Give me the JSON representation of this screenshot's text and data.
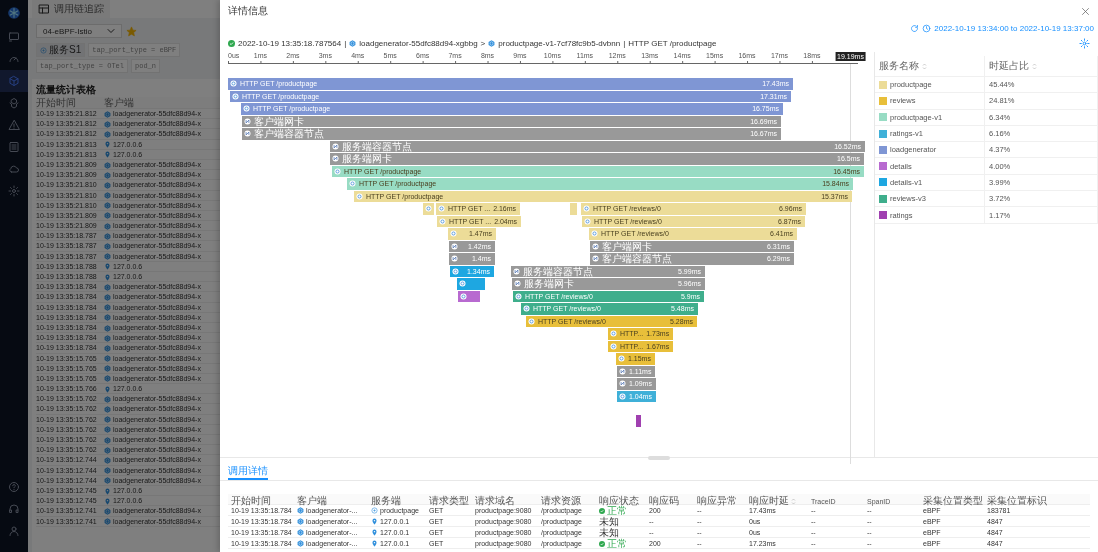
{
  "page": {
    "nav_items": [
      {
        "selected": false
      },
      {
        "selected": false
      },
      {
        "selected": true
      },
      {
        "selected": false
      },
      {
        "selected": false
      },
      {
        "selected": false
      },
      {
        "selected": false
      },
      {
        "selected": false
      },
      {
        "selected": false
      },
      {
        "selected": false
      },
      {
        "selected": false
      }
    ],
    "tab_title": "调用链追踪",
    "dropdown": "04-eBPF-Istio",
    "starred": true,
    "filters": [
      {
        "label": "服务S1",
        "kind": "service"
      },
      {
        "label": "tap_port_type = eBPF",
        "kind": "tag"
      },
      {
        "label": "tap_port_type = OTel",
        "kind": "tag"
      },
      {
        "label": "pod_n",
        "kind": "tag"
      }
    ],
    "table_title": "流量统计表格",
    "columns": [
      "开始时间",
      "客户端"
    ],
    "rows": [
      {
        "time": "10-19 13:35:21.812",
        "client": "loadgenerator-55dfc88d94-x",
        "kind": "pod"
      },
      {
        "time": "10-19 13:35:21.812",
        "client": "loadgenerator-55dfc88d94-x",
        "kind": "pod"
      },
      {
        "time": "10-19 13:35:21.812",
        "client": "loadgenerator-55dfc88d94-x",
        "kind": "pod"
      },
      {
        "time": "10-19 13:35:21.813",
        "client": "127.0.0.6",
        "kind": "ip"
      },
      {
        "time": "10-19 13:35:21.813",
        "client": "127.0.0.6",
        "kind": "ip"
      },
      {
        "time": "10-19 13:35:21.809",
        "client": "loadgenerator-55dfc88d94-x",
        "kind": "pod"
      },
      {
        "time": "10-19 13:35:21.809",
        "client": "loadgenerator-55dfc88d94-x",
        "kind": "pod"
      },
      {
        "time": "10-19 13:35:21.810",
        "client": "loadgenerator-55dfc88d94-x",
        "kind": "pod"
      },
      {
        "time": "10-19 13:35:21.810",
        "client": "loadgenerator-55dfc88d94-x",
        "kind": "pod"
      },
      {
        "time": "10-19 13:35:21.810",
        "client": "loadgenerator-55dfc88d94-x",
        "kind": "pod"
      },
      {
        "time": "10-19 13:35:21.809",
        "client": "loadgenerator-55dfc88d94-x",
        "kind": "pod"
      },
      {
        "time": "10-19 13:35:21.809",
        "client": "loadgenerator-55dfc88d94-x",
        "kind": "pod"
      },
      {
        "time": "10-19 13:35:18.787",
        "client": "loadgenerator-55dfc88d94-x",
        "kind": "pod"
      },
      {
        "time": "10-19 13:35:18.787",
        "client": "loadgenerator-55dfc88d94-x",
        "kind": "pod"
      },
      {
        "time": "10-19 13:35:18.787",
        "client": "loadgenerator-55dfc88d94-x",
        "kind": "pod"
      },
      {
        "time": "10-19 13:35:18.788",
        "client": "127.0.0.6",
        "kind": "ip"
      },
      {
        "time": "10-19 13:35:18.788",
        "client": "127.0.0.6",
        "kind": "ip"
      },
      {
        "time": "10-19 13:35:18.784",
        "client": "loadgenerator-55dfc88d94-x",
        "kind": "pod"
      },
      {
        "time": "10-19 13:35:18.784",
        "client": "loadgenerator-55dfc88d94-x",
        "kind": "pod"
      },
      {
        "time": "10-19 13:35:18.784",
        "client": "loadgenerator-55dfc88d94-x",
        "kind": "pod"
      },
      {
        "time": "10-19 13:35:18.784",
        "client": "loadgenerator-55dfc88d94-x",
        "kind": "pod"
      },
      {
        "time": "10-19 13:35:18.784",
        "client": "loadgenerator-55dfc88d94-x",
        "kind": "pod"
      },
      {
        "time": "10-19 13:35:18.784",
        "client": "loadgenerator-55dfc88d94-x",
        "kind": "pod"
      },
      {
        "time": "10-19 13:35:18.784",
        "client": "loadgenerator-55dfc88d94-x",
        "kind": "pod"
      },
      {
        "time": "10-19 13:35:15.765",
        "client": "loadgenerator-55dfc88d94-x",
        "kind": "pod"
      },
      {
        "time": "10-19 13:35:15.765",
        "client": "loadgenerator-55dfc88d94-x",
        "kind": "pod"
      },
      {
        "time": "10-19 13:35:15.765",
        "client": "loadgenerator-55dfc88d94-x",
        "kind": "pod"
      },
      {
        "time": "10-19 13:35:15.766",
        "client": "127.0.0.6",
        "kind": "ip"
      },
      {
        "time": "10-19 13:35:15.762",
        "client": "loadgenerator-55dfc88d94-x",
        "kind": "pod"
      },
      {
        "time": "10-19 13:35:15.762",
        "client": "loadgenerator-55dfc88d94-x",
        "kind": "pod"
      },
      {
        "time": "10-19 13:35:15.762",
        "client": "loadgenerator-55dfc88d94-x",
        "kind": "pod"
      },
      {
        "time": "10-19 13:35:15.762",
        "client": "loadgenerator-55dfc88d94-x",
        "kind": "pod"
      },
      {
        "time": "10-19 13:35:15.762",
        "client": "loadgenerator-55dfc88d94-x",
        "kind": "pod"
      },
      {
        "time": "10-19 13:35:15.762",
        "client": "loadgenerator-55dfc88d94-x",
        "kind": "pod"
      },
      {
        "time": "10-19 13:35:12.744",
        "client": "loadgenerator-55dfc88d94-x",
        "kind": "pod"
      },
      {
        "time": "10-19 13:35:12.744",
        "client": "loadgenerator-55dfc88d94-x",
        "kind": "pod"
      },
      {
        "time": "10-19 13:35:12.744",
        "client": "loadgenerator-55dfc88d94-x",
        "kind": "pod"
      },
      {
        "time": "10-19 13:35:12.745",
        "client": "127.0.0.6",
        "kind": "ip"
      },
      {
        "time": "10-19 13:35:12.745",
        "client": "127.0.0.6",
        "kind": "ip"
      },
      {
        "time": "10-19 13:35:12.741",
        "client": "loadgenerator-55dfc88d94-x",
        "kind": "pod"
      },
      {
        "time": "10-19 13:35:12.741",
        "client": "loadgenerator-55dfc88d94-x",
        "kind": "pod"
      }
    ]
  },
  "drawer": {
    "title": "详情信息",
    "time_range": "2022-10-19 13:34:00 to 2022-10-19 13:37:00",
    "breadcrumb": {
      "time": "2022-10-19 13:35:18.787564",
      "separators": [
        "|",
        ">",
        "|"
      ],
      "source": "loadgenerator-55dfc88d94-xgbbg",
      "target": "productpage-v1-7cf78fc9b5-dvbnn",
      "endpoint": "HTTP GET /productpage"
    },
    "axis": {
      "ticks": [
        "0us",
        "1ms",
        "2ms",
        "3ms",
        "4ms",
        "5ms",
        "6ms",
        "7ms",
        "8ms",
        "9ms",
        "10ms",
        "11ms",
        "12ms",
        "13ms",
        "14ms",
        "15ms",
        "16ms",
        "17ms",
        "18ms"
      ],
      "end": "19.19ms"
    },
    "rows": [
      {
        "spans": [
          {
            "kind": "service",
            "label": "HTTP GET /productpage",
            "duration": "17.43ms",
            "color": "#7f96d4"
          }
        ]
      },
      {
        "spans": [
          {
            "kind": "service",
            "label": "HTTP GET /productpage",
            "duration": "17.31ms",
            "color": "#7f96d4"
          }
        ]
      },
      {
        "spans": [
          {
            "kind": "service",
            "label": "HTTP GET /productpage",
            "duration": "16.75ms",
            "color": "#7f96d4"
          }
        ]
      },
      {
        "spans": [
          {
            "kind": "network",
            "label": "客户端网卡",
            "duration": "16.69ms",
            "color": "#999999"
          }
        ]
      },
      {
        "spans": [
          {
            "kind": "network",
            "label": "客户端容器节点",
            "duration": "16.67ms",
            "color": "#999999"
          }
        ]
      },
      {
        "spans": [
          {
            "kind": "network",
            "label": "服务端容器节点",
            "duration": "16.52ms",
            "color": "#999999"
          }
        ]
      },
      {
        "spans": [
          {
            "kind": "network",
            "label": "服务端网卡",
            "duration": "16.5ms",
            "color": "#999999"
          }
        ]
      },
      {
        "spans": [
          {
            "kind": "service",
            "label": "HTTP GET /productpage",
            "duration": "16.45ms",
            "color": "#98dcc4"
          }
        ]
      },
      {
        "spans": [
          {
            "kind": "service",
            "label": "HTTP GET /productpage",
            "duration": "15.84ms",
            "color": "#98dcc4"
          }
        ]
      },
      {
        "spans": [
          {
            "kind": "service",
            "label": "HTTP GET /productpage",
            "duration": "15.37ms",
            "color": "#ecdc98"
          }
        ]
      },
      {
        "spans": [
          {
            "kind": "service",
            "color": "#ecdc98"
          },
          {
            "kind": "service",
            "label": "HTTP GET ...",
            "duration": "2.16ms",
            "color": "#ecdc98"
          },
          {
            "kind": "none",
            "color": "#ecdc98"
          },
          {
            "kind": "service",
            "label": "HTTP GET /reviews/0",
            "duration": "6.96ms",
            "color": "#ecdc98"
          }
        ]
      },
      {
        "spans": [
          {
            "kind": "service",
            "label": "HTTP GET ...",
            "duration": "2.04ms",
            "color": "#ecdc98"
          },
          {
            "kind": "service",
            "label": "HTTP GET /reviews/0",
            "duration": "6.87ms",
            "color": "#ecdc98"
          }
        ]
      },
      {
        "spans": [
          {
            "kind": "service",
            "duration": "1.47ms",
            "color": "#ecdc98"
          },
          {
            "kind": "service",
            "label": "HTTP GET /reviews/0",
            "duration": "6.41ms",
            "color": "#ecdc98"
          }
        ]
      },
      {
        "spans": [
          {
            "kind": "network",
            "duration": "1.42ms",
            "color": "#999999"
          },
          {
            "kind": "network",
            "label": "客户端网卡",
            "duration": "6.31ms",
            "color": "#999999"
          }
        ]
      },
      {
        "spans": [
          {
            "kind": "network",
            "duration": "1.4ms",
            "color": "#999999"
          },
          {
            "kind": "network",
            "label": "客户端容器节点",
            "duration": "6.29ms",
            "color": "#999999"
          }
        ]
      },
      {
        "spans": [
          {
            "kind": "service",
            "duration": "1.34ms",
            "color": "#1ea7e1"
          },
          {
            "kind": "network",
            "label": "服务端容器节点",
            "duration": "5.99ms",
            "color": "#999999"
          }
        ]
      },
      {
        "spans": [
          {
            "kind": "service",
            "color": "#1ea7e1"
          },
          {
            "kind": "network",
            "label": "服务端网卡",
            "duration": "5.96ms",
            "color": "#999999"
          }
        ]
      },
      {
        "spans": [
          {
            "kind": "service",
            "color": "#b86ad0"
          },
          {
            "kind": "service",
            "label": "HTTP GET /reviews/0",
            "duration": "5.9ms",
            "color": "#3fae8c"
          }
        ]
      },
      {
        "spans": [
          {
            "kind": "service",
            "label": "HTTP GET /reviews/0",
            "duration": "5.48ms",
            "color": "#3fae8c"
          }
        ]
      },
      {
        "spans": [
          {
            "kind": "service",
            "label": "HTTP GET /reviews/0",
            "duration": "5.28ms",
            "color": "#e8bf3a"
          }
        ]
      },
      {
        "spans": [
          {
            "kind": "service",
            "label": "HTTP...",
            "duration": "1.73ms",
            "color": "#e8bf3a"
          }
        ]
      },
      {
        "spans": [
          {
            "kind": "service",
            "label": "HTTP...",
            "duration": "1.67ms",
            "color": "#e8bf3a"
          }
        ]
      },
      {
        "spans": [
          {
            "kind": "service",
            "duration": "1.15ms",
            "color": "#e8bf3a"
          }
        ]
      },
      {
        "spans": [
          {
            "kind": "network",
            "duration": "1.11ms",
            "color": "#999999"
          }
        ]
      },
      {
        "spans": [
          {
            "kind": "network",
            "duration": "1.09ms",
            "color": "#999999"
          }
        ]
      },
      {
        "spans": [
          {
            "kind": "service",
            "duration": "1.04ms",
            "color": "#3fb0d8"
          }
        ]
      },
      {
        "spans": [
          {
            "kind": "none",
            "color": "#a040b0"
          }
        ]
      }
    ],
    "legend": {
      "columns": [
        {
          "label": "服务名称",
          "sortable": true
        },
        {
          "label": "时延占比",
          "sortable": true
        }
      ],
      "rows": [
        {
          "name": "productpage",
          "share": "45.44%",
          "color": "#ecdc98"
        },
        {
          "name": "reviews",
          "share": "24.81%",
          "color": "#e8bf3a"
        },
        {
          "name": "productpage-v1",
          "share": "6.34%",
          "color": "#98dcc4"
        },
        {
          "name": "ratings-v1",
          "share": "6.16%",
          "color": "#3fb0d8"
        },
        {
          "name": "loadgenerator",
          "share": "4.37%",
          "color": "#7f96d4"
        },
        {
          "name": "details",
          "share": "4.00%",
          "color": "#b86ad0"
        },
        {
          "name": "details-v1",
          "share": "3.99%",
          "color": "#1ea7e1"
        },
        {
          "name": "reviews-v3",
          "share": "3.72%",
          "color": "#3fae8c"
        },
        {
          "name": "ratings",
          "share": "1.17%",
          "color": "#a040b0"
        }
      ]
    },
    "tabs": [
      {
        "label": "调用详情",
        "selected": true
      }
    ],
    "table": {
      "columns": [
        {
          "label": "开始时间"
        },
        {
          "label": "客户端"
        },
        {
          "label": "服务端"
        },
        {
          "label": "请求类型"
        },
        {
          "label": "请求域名"
        },
        {
          "label": "请求资源"
        },
        {
          "label": "响应状态"
        },
        {
          "label": "响应码"
        },
        {
          "label": "响应异常"
        },
        {
          "label": "响应时延",
          "sortable": true
        },
        {
          "label": "TraceID"
        },
        {
          "label": "SpanID"
        },
        {
          "label": "采集位置类型"
        },
        {
          "label": "采集位置标识"
        }
      ],
      "rows": [
        {
          "time": "10-19 13:35:18.784",
          "client": {
            "kind": "pod",
            "name": "loadgenerator-..."
          },
          "server": {
            "kind": "service",
            "name": "productpage"
          },
          "method": "GET",
          "domain": "productpage:9080",
          "resource": "/productpage",
          "status": {
            "kind": "ok",
            "text": "正常"
          },
          "code": "200",
          "exception": "--",
          "latency": "17.43ms",
          "trace_id": "--",
          "span_id": "--",
          "capture_type": "eBPF",
          "capture_id": "183781"
        },
        {
          "time": "10-19 13:35:18.784",
          "client": {
            "kind": "pod",
            "name": "loadgenerator-..."
          },
          "server": {
            "kind": "ip",
            "name": "127.0.0.1"
          },
          "method": "GET",
          "domain": "productpage:9080",
          "resource": "/productpage",
          "status": {
            "kind": "unknown",
            "text": "未知"
          },
          "code": "--",
          "exception": "--",
          "latency": "0us",
          "trace_id": "--",
          "span_id": "--",
          "capture_type": "eBPF",
          "capture_id": "4847"
        },
        {
          "time": "10-19 13:35:18.784",
          "client": {
            "kind": "pod",
            "name": "loadgenerator-..."
          },
          "server": {
            "kind": "ip",
            "name": "127.0.0.1"
          },
          "method": "GET",
          "domain": "productpage:9080",
          "resource": "/productpage",
          "status": {
            "kind": "unknown",
            "text": "未知"
          },
          "code": "--",
          "exception": "--",
          "latency": "0us",
          "trace_id": "--",
          "span_id": "--",
          "capture_type": "eBPF",
          "capture_id": "4847"
        },
        {
          "time": "10-19 13:35:18.784",
          "client": {
            "kind": "pod",
            "name": "loadgenerator-..."
          },
          "server": {
            "kind": "ip",
            "name": "127.0.0.1"
          },
          "method": "GET",
          "domain": "productpage:9080",
          "resource": "/productpage",
          "status": {
            "kind": "ok",
            "text": "正常"
          },
          "code": "200",
          "exception": "--",
          "latency": "17.23ms",
          "trace_id": "--",
          "span_id": "--",
          "capture_type": "eBPF",
          "capture_id": "4847"
        }
      ]
    }
  }
}
